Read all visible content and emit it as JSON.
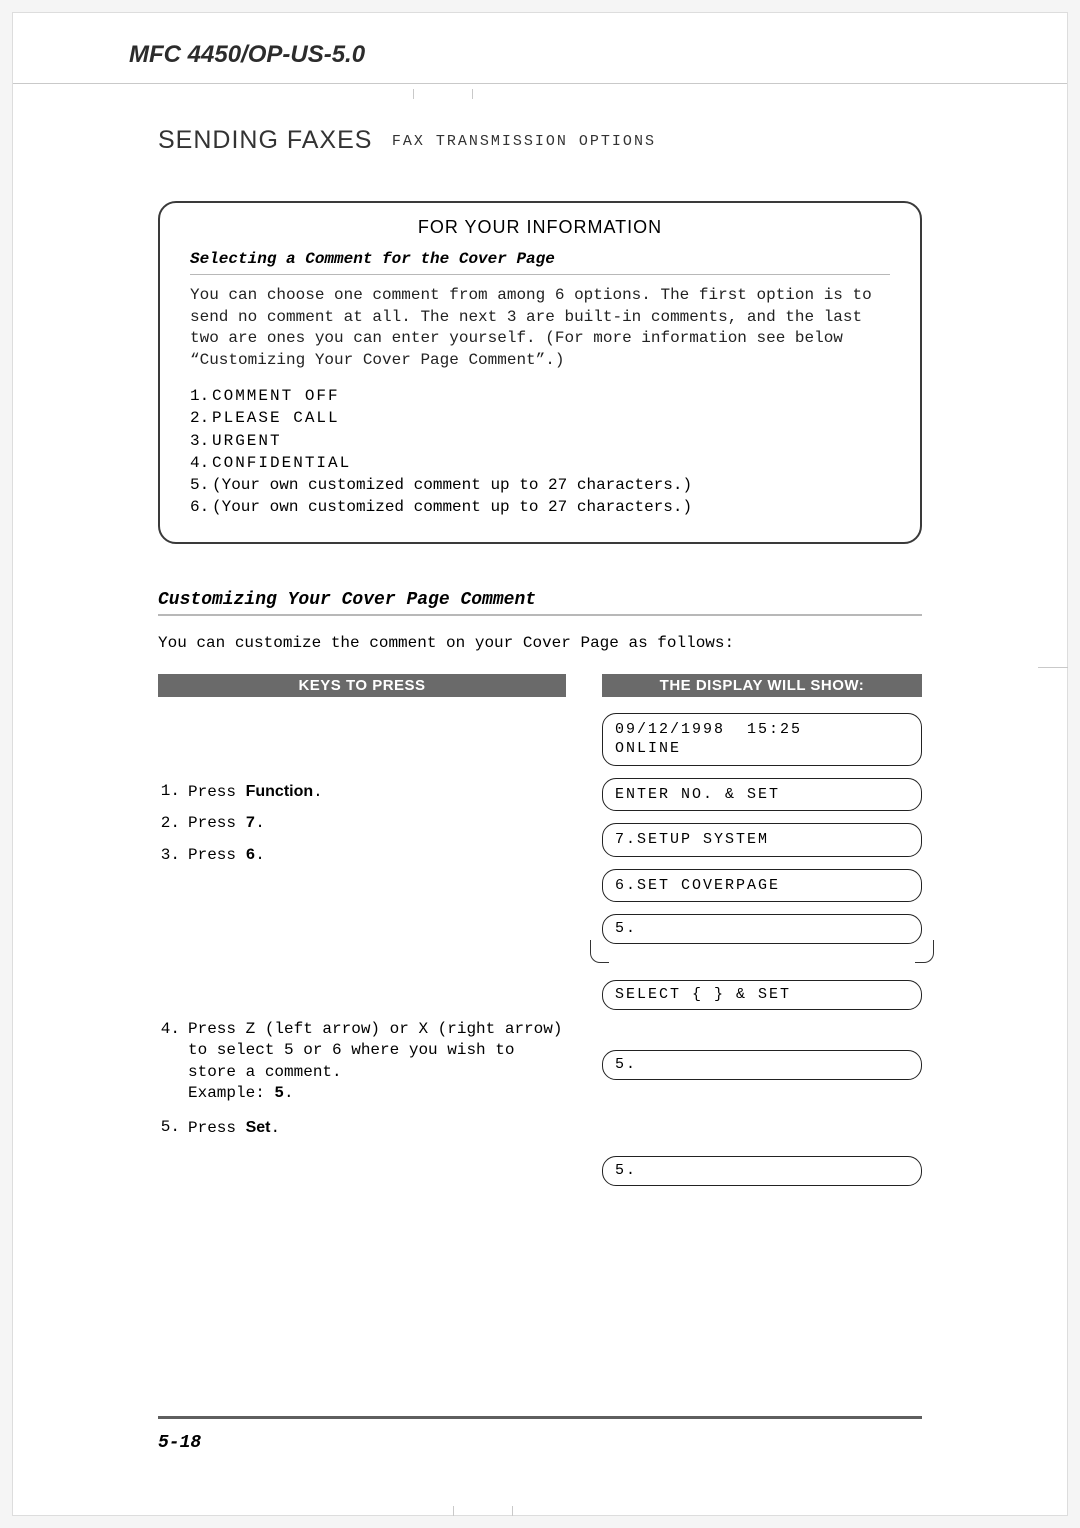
{
  "doc_header": "MFC 4450/OP-US-5.0",
  "section_title_big": "SENDING FAXES",
  "section_title_small": "FAX TRANSMISSION OPTIONS",
  "info": {
    "title": "FOR YOUR INFORMATION",
    "subtitle": "Selecting a Comment for the Cover Page",
    "body": "You can choose one comment from among 6 options. The first option is to send no comment at all. The next 3 are built-in comments, and the last two are ones you can enter yourself. (For more information see below “Customizing Your Cover Page Comment”.)",
    "items": [
      {
        "n": "1.",
        "txt": "COMMENT  OFF",
        "spaced": true
      },
      {
        "n": "2.",
        "txt": "PLEASE  CALL",
        "spaced": true
      },
      {
        "n": "3.",
        "txt": "URGENT",
        "spaced": true
      },
      {
        "n": "4.",
        "txt": "CONFIDENTIAL",
        "spaced": true
      },
      {
        "n": "5.",
        "txt": "(Your own customized comment up to 27 characters.)",
        "spaced": false
      },
      {
        "n": "6.",
        "txt": "(Your own customized comment up to 27 characters.)",
        "spaced": false
      }
    ]
  },
  "subhead": "Customizing Your Cover Page Comment",
  "subhead_intro": "You can customize the comment on your Cover Page as follows:",
  "col_left_head": "KEYS TO PRESS",
  "col_right_head": "THE DISPLAY WILL SHOW:",
  "steps": [
    {
      "n": "1.",
      "pre": "Press ",
      "bold": "Function",
      "post": "."
    },
    {
      "n": "2.",
      "pre": "Press ",
      "bold": "7",
      "post": "."
    },
    {
      "n": "3.",
      "pre": "Press ",
      "bold": "6",
      "post": "."
    },
    {
      "n": "4.",
      "pre": "Press Z (left arrow) or X (right arrow) to select 5 or 6 where you wish to store a comment.\nExample: ",
      "bold": "5",
      "post": "."
    },
    {
      "n": "5.",
      "pre": "Press ",
      "bold": "Set",
      "post": "."
    }
  ],
  "displays": {
    "d0": "09/12/1998  15:25\nONLINE",
    "d1": "ENTER NO. & SET",
    "d2": "7.SETUP SYSTEM",
    "d3": "6.SET COVERPAGE",
    "d4": "5.",
    "d5": "SELECT { } & SET",
    "d6": "5.",
    "d7": "5."
  },
  "page_number": "5-18"
}
